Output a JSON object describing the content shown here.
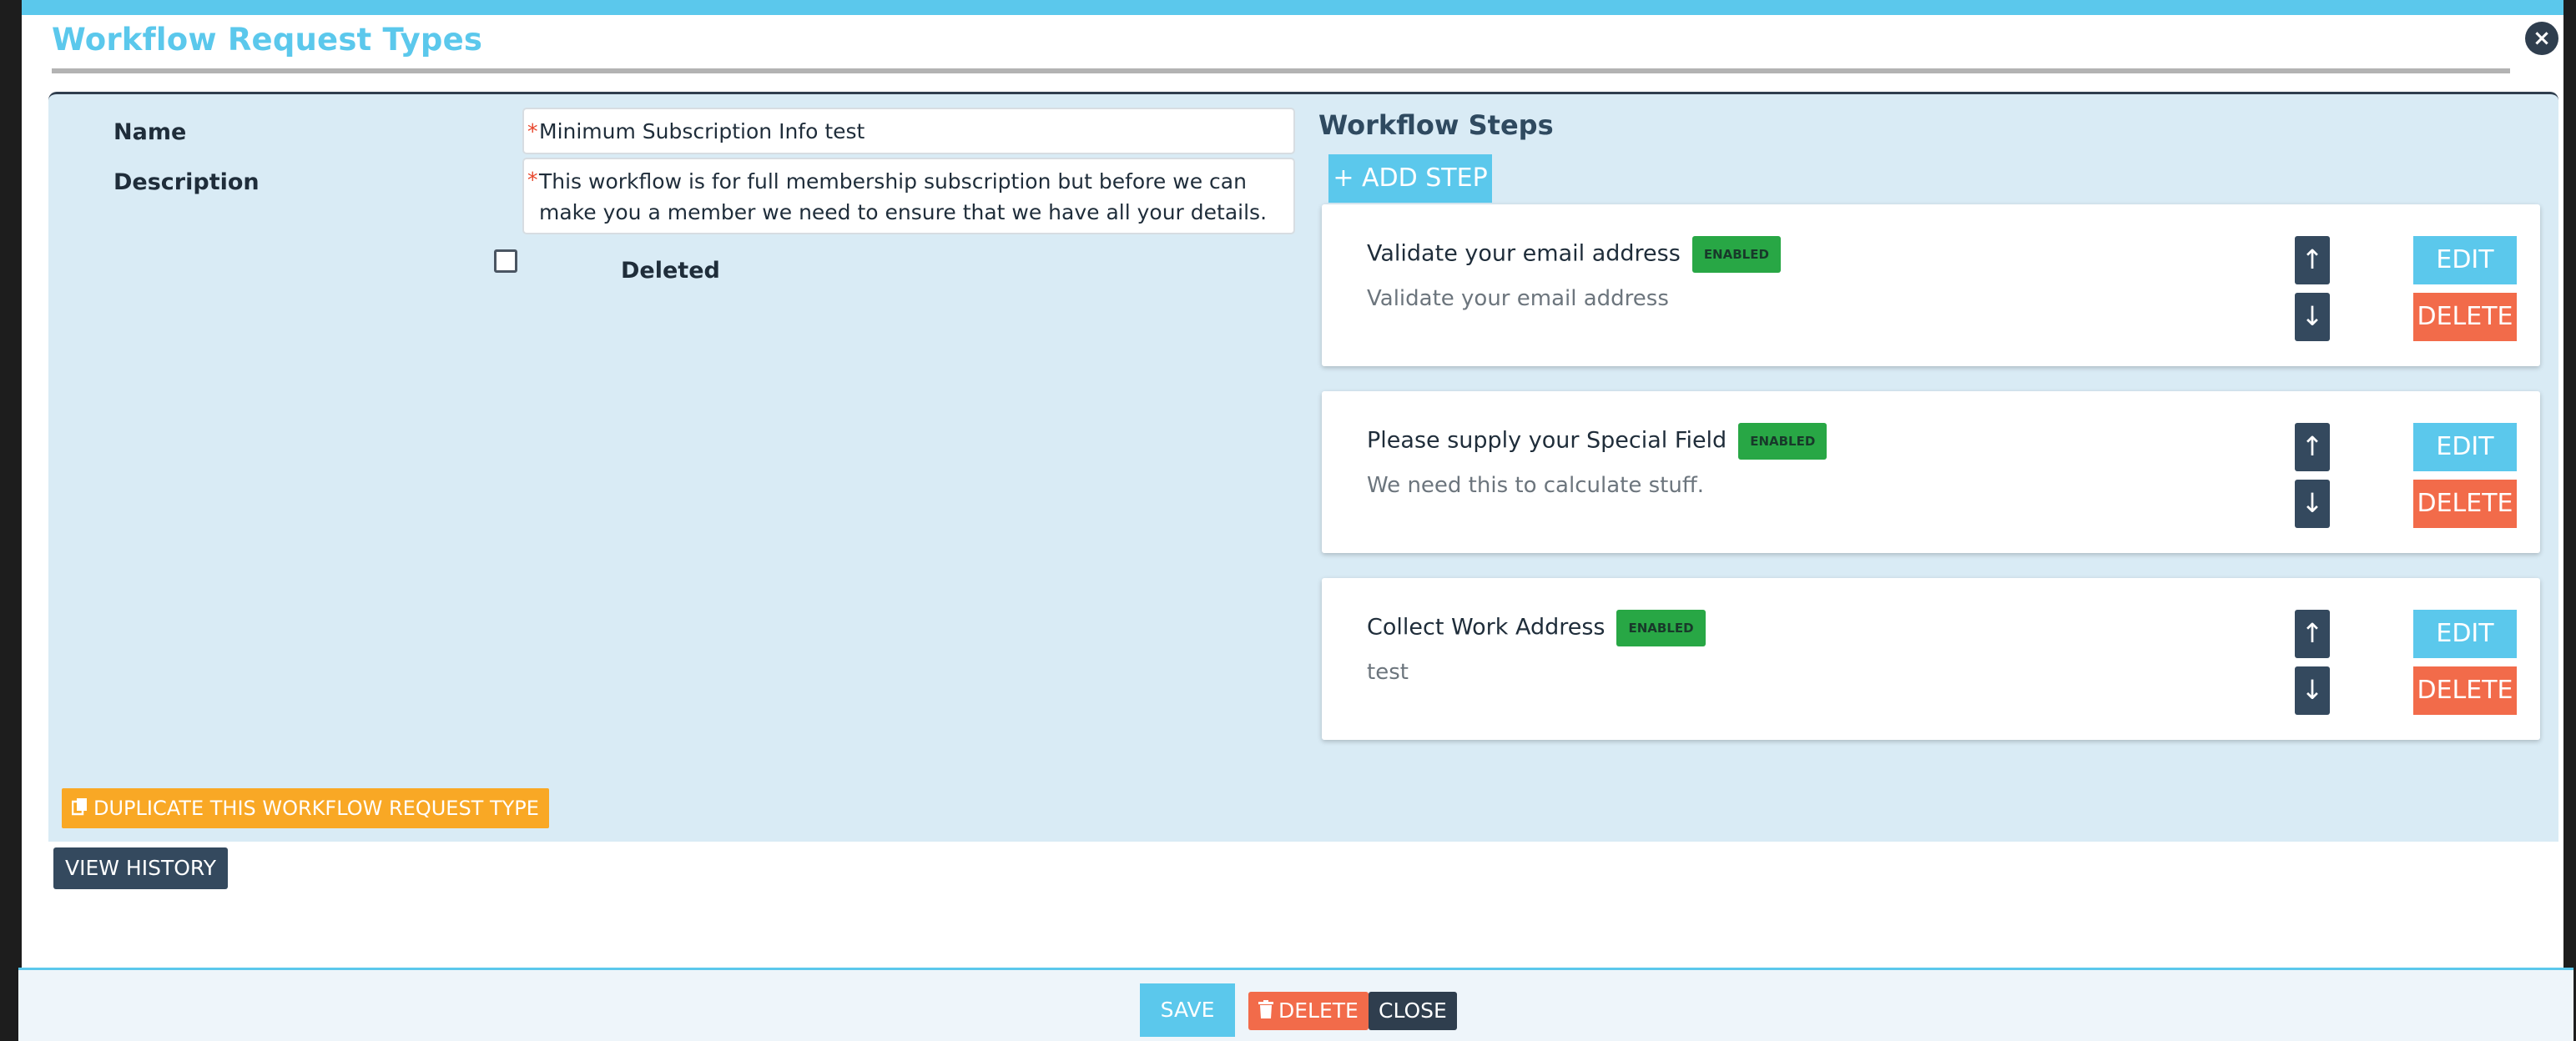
{
  "dialog": {
    "title": "Workflow Request Types",
    "close_glyph": "×"
  },
  "form": {
    "name_label": "Name",
    "name_value": "Minimum Subscription Info test",
    "description_label": "Description",
    "description_value": "This workflow is for full membership subscription but before we can make you a member we need to ensure that we have all your details.",
    "required_mark": "*",
    "deleted_label": "Deleted",
    "deleted_checked": false
  },
  "workflow_steps": {
    "title": "Workflow Steps",
    "add_step_label": "+ ADD STEP",
    "up_glyph": "↑",
    "down_glyph": "↓",
    "edit_label": "EDIT",
    "delete_label": "DELETE",
    "steps": [
      {
        "title": "Validate your email address",
        "badge": "ENABLED",
        "description": "Validate your email address"
      },
      {
        "title": "Please supply your Special Field",
        "badge": "ENABLED",
        "description": "We need this to calculate stuff."
      },
      {
        "title": "Collect Work Address",
        "badge": "ENABLED",
        "description": "test"
      }
    ]
  },
  "actions": {
    "duplicate_label": "DUPLICATE THIS WORKFLOW REQUEST TYPE",
    "view_history_label": "VIEW HISTORY"
  },
  "footer": {
    "save_label": "SAVE",
    "delete_label": "DELETE",
    "close_label": "CLOSE"
  },
  "colors": {
    "accent": "#5bc8ec",
    "danger": "#f26b4a",
    "dark": "#2f3e4e",
    "warning": "#f9a825",
    "success": "#28a745",
    "panel_bg": "#d9ebf5"
  },
  "icons": {
    "duplicate": "copy-icon",
    "delete": "trash-icon",
    "close": "close-icon"
  }
}
